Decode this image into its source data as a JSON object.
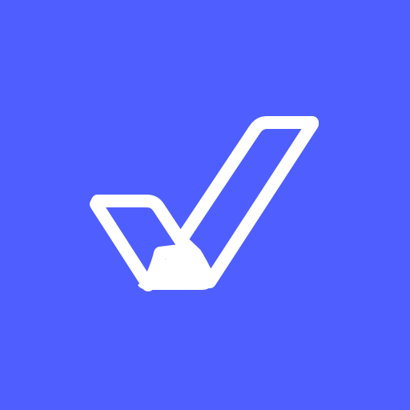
{
  "app_icon": {
    "icon": "checkmark-icon",
    "colors": {
      "background": "#4f5fff",
      "mark": "#ffffff"
    }
  }
}
